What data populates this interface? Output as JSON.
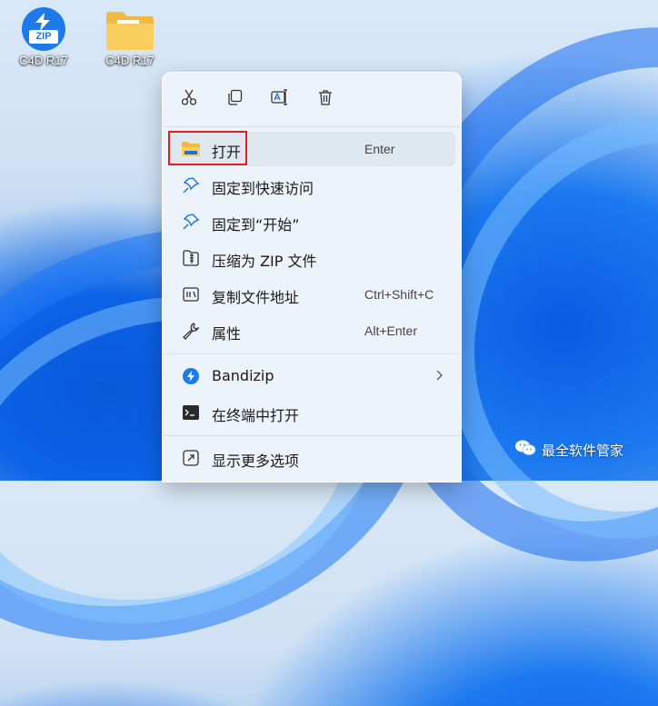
{
  "desktop": {
    "icons": [
      {
        "label": "C4D R17",
        "type": "zip-icon"
      },
      {
        "label": "C4D R17",
        "type": "folder-icon"
      }
    ]
  },
  "context_menu": {
    "toolbar": [
      "cut-icon",
      "copy-icon",
      "rename-icon",
      "delete-icon"
    ],
    "items": [
      {
        "label": "打开",
        "shortcut": "Enter",
        "icon": "folder-open-icon"
      },
      {
        "label": "固定到快速访问",
        "shortcut": "",
        "icon": "pin-icon"
      },
      {
        "label": "固定到“开始”",
        "shortcut": "",
        "icon": "pin-icon"
      },
      {
        "label": "压缩为 ZIP 文件",
        "shortcut": "",
        "icon": "zip-file-icon"
      },
      {
        "label": "复制文件地址",
        "shortcut": "Ctrl+Shift+C",
        "icon": "copy-path-icon"
      },
      {
        "label": "属性",
        "shortcut": "Alt+Enter",
        "icon": "wrench-icon"
      },
      {
        "label": "Bandizip",
        "shortcut": "",
        "icon": "bandizip-icon"
      },
      {
        "label": "在终端中打开",
        "shortcut": "",
        "icon": "terminal-icon"
      },
      {
        "label": "显示更多选项",
        "shortcut": "",
        "icon": "more-options-icon"
      }
    ]
  },
  "watermark": {
    "text": "最全软件管家"
  },
  "colors": {
    "accent": "#1c7be8",
    "highlight_border": "#e02020",
    "menu_bg": "#edf3fa"
  }
}
